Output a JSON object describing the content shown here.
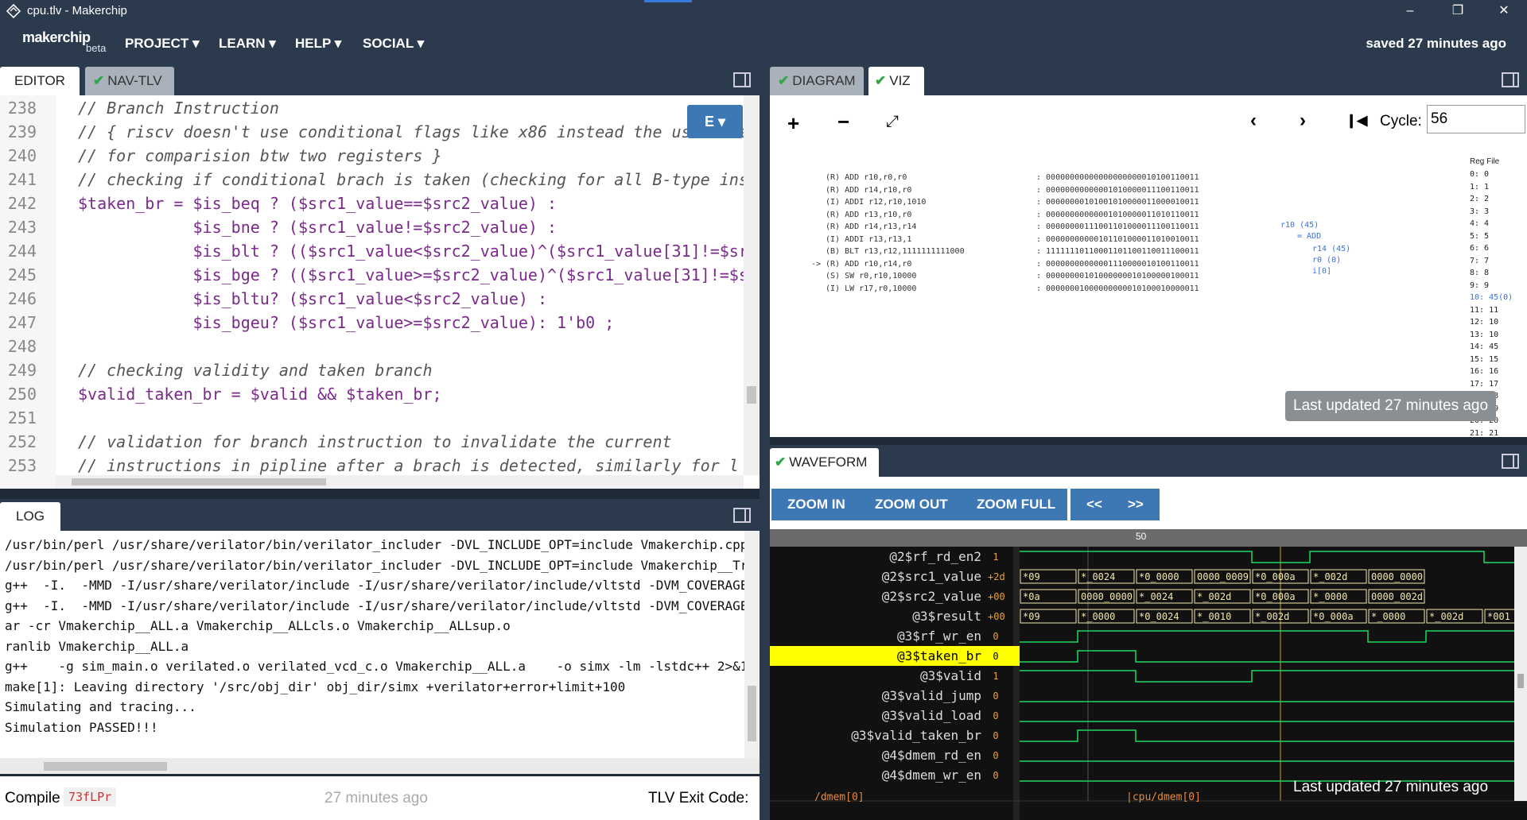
{
  "window": {
    "title": "cpu.tlv - Makerchip"
  },
  "menubar": {
    "brand": "makerchip",
    "beta": "beta",
    "items": [
      "PROJECT",
      "LEARN",
      "HELP",
      "SOCIAL"
    ],
    "saved": "saved 27 minutes ago"
  },
  "left_tabs": {
    "editor": "EDITOR",
    "nav": "NAV-TLV"
  },
  "right_tabs": {
    "diagram": "DIAGRAM",
    "viz": "VIZ"
  },
  "editor": {
    "menu_button": "E",
    "lines": [
      {
        "n": "238",
        "t": "// Branch Instruction"
      },
      {
        "n": "239",
        "t": "// { riscv doesn't use conditional flags like x86 instead the uses bra"
      },
      {
        "n": "240",
        "t": "// for comparision btw two registers }"
      },
      {
        "n": "241",
        "t": "// checking if conditional brach is taken (checking for all B-type ins"
      },
      {
        "n": "242",
        "t": "$taken_br = $is_beq ? ($src1_value==$src2_value) :"
      },
      {
        "n": "243",
        "t": "            $is_bne ? ($src1_value!=$src2_value) :"
      },
      {
        "n": "244",
        "t": "            $is_blt ? (($src1_value<$src2_value)^($src1_value[31]!=$sr"
      },
      {
        "n": "245",
        "t": "            $is_bge ? (($src1_value>=$src2_value)^($src1_value[31]!=$s"
      },
      {
        "n": "246",
        "t": "            $is_bltu? ($src1_value<$src2_value) :"
      },
      {
        "n": "247",
        "t": "            $is_bgeu? ($src1_value>=$src2_value): 1'b0 ;"
      },
      {
        "n": "248",
        "t": ""
      },
      {
        "n": "249",
        "t": "// checking validity and taken branch"
      },
      {
        "n": "250",
        "t": "$valid_taken_br = $valid && $taken_br;"
      },
      {
        "n": "251",
        "t": ""
      },
      {
        "n": "252",
        "t": "// validation for branch instruction to invalidate the current"
      },
      {
        "n": "253",
        "t": "// instructions in pipline after a brach is detected, similarly for l"
      }
    ]
  },
  "log": {
    "tab": "LOG",
    "lines": [
      "/usr/bin/perl /usr/share/verilator/bin/verilator_includer -DVL_INCLUDE_OPT=include Vmakerchip.cpp >",
      "/usr/bin/perl /usr/share/verilator/bin/verilator_includer -DVL_INCLUDE_OPT=include Vmakerchip__Trac",
      "g++  -I.  -MMD -I/usr/share/verilator/include -I/usr/share/verilator/include/vltstd -DVM_COVERAGE=0",
      "g++  -I.  -MMD -I/usr/share/verilator/include -I/usr/share/verilator/include/vltstd -DVM_COVERAGE=0",
      "ar -cr Vmakerchip__ALL.a Vmakerchip__ALLcls.o Vmakerchip__ALLsup.o",
      "ranlib Vmakerchip__ALL.a",
      "g++    -g sim_main.o verilated.o verilated_vcd_c.o Vmakerchip__ALL.a    -o simx -lm -lstdc++ 2>&1 |",
      "make[1]: Leaving directory '/src/obj_dir' obj_dir/simx +verilator+error+limit+100",
      "Simulating and tracing...",
      "Simulation PASSED!!!"
    ]
  },
  "compile": {
    "label": "Compile",
    "id": "73fLPr",
    "time": "27 minutes ago",
    "exit": "TLV Exit Code:"
  },
  "viz": {
    "cycle_label": "Cycle:",
    "cycle_value": "56",
    "instr": [
      "(R) ADD r10,r0,r0",
      "(R) ADD r14,r10,r0",
      "(I) ADDI r12,r10,1010",
      "(R) ADD r13,r10,r0",
      "(R) ADD r14,r13,r14",
      "(I) ADDI r13,r13,1",
      "(B) BLT r13,r12,1111111111000",
      "(R) ADD r10,r14,r0",
      "(S) SW r0,r10,10000",
      "(I) LW r17,r0,10000"
    ],
    "pointer": "->",
    "bits": [
      ": 00000000000000000000010100110011",
      ": 00000000000001010000011100110011",
      ": 00000000101001010000011000010011",
      ": 00000000000001010000011010110011",
      ": 00000000111001101000011100110011",
      ": 00000000000101101000011010010011",
      ": 11111110110001101100110011100011",
      ": 00000000000001110000010100110011",
      ": 00000000101000000010100000100011",
      ": 00000001000000000010100010000011"
    ],
    "op": [
      "r10 (45)",
      "= ADD",
      "r14 (45)",
      "r0 (0)",
      "i[0]"
    ],
    "reg_title": "Reg File",
    "regs": [
      "0: 0",
      "1: 1",
      "2: 2",
      "3: 3",
      "4: 4",
      "5: 5",
      "6: 6",
      "7: 7",
      "8: 8",
      "9: 9",
      "10: 45(0)",
      "11: 11",
      "12: 10",
      "13: 10",
      "14: 45",
      "15: 15",
      "16: 16",
      "17: 17",
      "18: 18",
      "19: 19",
      "20: 20",
      "21: 21"
    ],
    "toast": "Last updated 27 minutes ago"
  },
  "waveform": {
    "tab": "WAVEFORM",
    "buttons": [
      "ZOOM IN",
      "ZOOM OUT",
      "ZOOM FULL",
      "<<",
      ">>"
    ],
    "ruler": "50",
    "signals": [
      {
        "name": "@2$rf_rd_en2",
        "val": "1"
      },
      {
        "name": "@2$src1_value",
        "val": "+2d"
      },
      {
        "name": "@2$src2_value",
        "val": "+00"
      },
      {
        "name": "@3$result",
        "val": "+00"
      },
      {
        "name": "@3$rf_wr_en",
        "val": "0"
      },
      {
        "name": "@3$taken_br",
        "val": "0"
      },
      {
        "name": "@3$valid",
        "val": "1"
      },
      {
        "name": "@3$valid_jump",
        "val": "0"
      },
      {
        "name": "@3$valid_load",
        "val": "0"
      },
      {
        "name": "@3$valid_taken_br",
        "val": "0"
      },
      {
        "name": "@4$dmem_rd_en",
        "val": "0"
      },
      {
        "name": "@4$dmem_wr_en",
        "val": "0"
      }
    ],
    "bus_src1": [
      "*09",
      "*_0024",
      "*0_0000",
      "0000_0009",
      "*0_000a",
      "*_002d",
      "0000_0000"
    ],
    "bus_src2": [
      "*0a",
      "0000_0000",
      "*_0024",
      "*_002d",
      "*0_000a",
      "*_0000",
      "0000_002d"
    ],
    "bus_result": [
      "*09",
      "*_0000",
      "*0_0024",
      "*_0010",
      "*_002d",
      "*0_000a",
      "*_0000",
      "*_002d",
      "*001"
    ],
    "footer_left": "/dmem[0]",
    "footer_mid": "|cpu/dmem[0]",
    "toast": "Last updated 27 minutes ago"
  }
}
